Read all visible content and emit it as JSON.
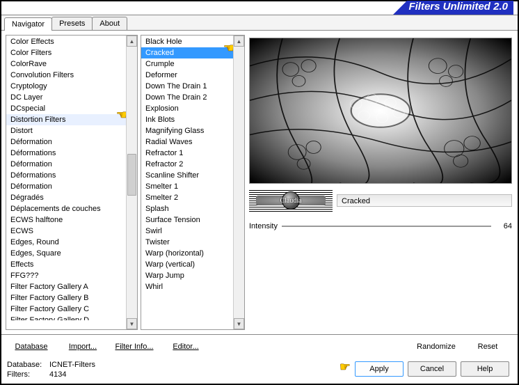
{
  "app": {
    "title": "Filters Unlimited 2.0"
  },
  "tabs": [
    {
      "label": "Navigator",
      "active": true
    },
    {
      "label": "Presets",
      "active": false
    },
    {
      "label": "About",
      "active": false
    }
  ],
  "categories": {
    "highlighted": "Distortion Filters",
    "items": [
      "Color Effects",
      "Color Filters",
      "ColorRave",
      "Convolution Filters",
      "Cryptology",
      "DC Layer",
      "DCspecial",
      "Distortion Filters",
      "Distort",
      "Déformation",
      "Déformations",
      "Déformation",
      "Déformations",
      "Déformation",
      "Dégradés",
      "Déplacements de couches",
      "ECWS halftone",
      "ECWS",
      "Edges, Round",
      "Edges, Square",
      "Effects",
      "FFG???",
      "Filter Factory Gallery A",
      "Filter Factory Gallery B",
      "Filter Factory Gallery C"
    ],
    "truncated_last": "Filter Factory Gallery D"
  },
  "filters": {
    "selected": "Cracked",
    "items": [
      "Black Hole",
      "Cracked",
      "Crumple",
      "Deformer",
      "Down The Drain 1",
      "Down The Drain 2",
      "Explosion",
      "Ink Blots",
      "Magnifying Glass",
      "Radial Waves",
      "Refractor 1",
      "Refractor 2",
      "Scanline Shifter",
      "Smelter 1",
      "Smelter 2",
      "Splash",
      "Surface Tension",
      "Swirl",
      "Twister",
      "Warp (horizontal)",
      "Warp (vertical)",
      "Warp Jump",
      "Whirl"
    ]
  },
  "preview": {
    "filter_name": "Cracked",
    "params": [
      {
        "label": "Intensity",
        "value": 64
      }
    ],
    "watermark_text": "Claudia"
  },
  "mid_buttons": {
    "database": "Database",
    "import": "Import...",
    "filter_info": "Filter Info...",
    "editor": "Editor...",
    "randomize": "Randomize",
    "reset": "Reset"
  },
  "status": {
    "database_label": "Database:",
    "database_value": "ICNET-Filters",
    "filters_label": "Filters:",
    "filters_value": "4134"
  },
  "bottom_buttons": {
    "apply": "Apply",
    "cancel": "Cancel",
    "help": "Help"
  }
}
